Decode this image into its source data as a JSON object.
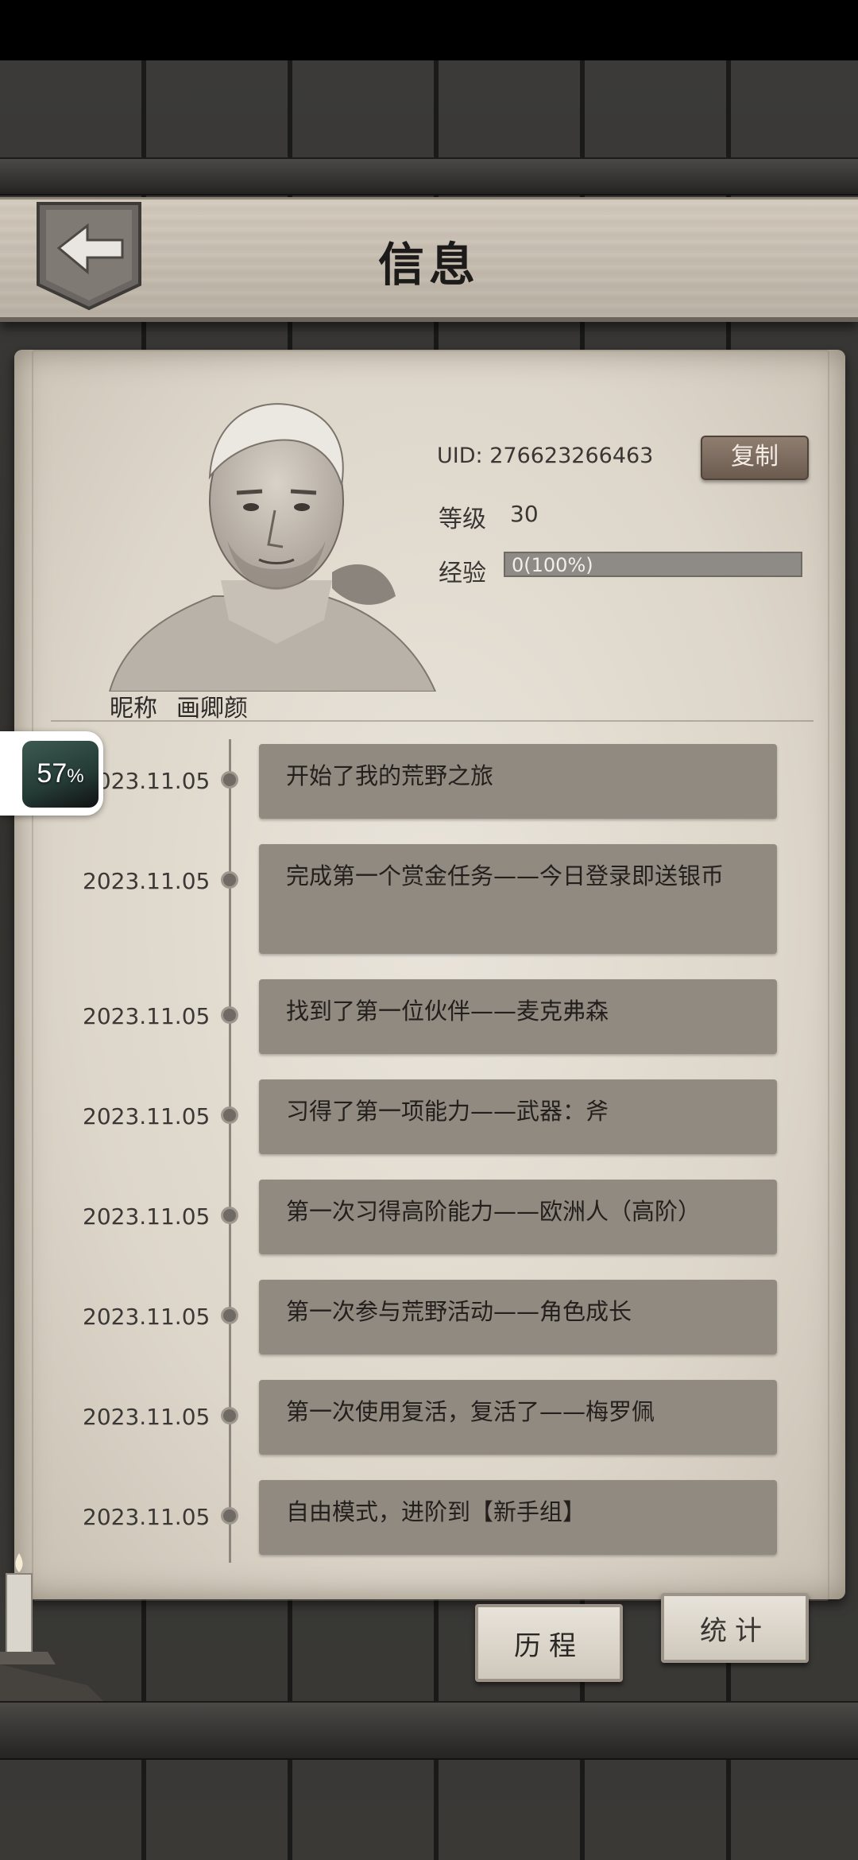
{
  "header": {
    "title": "信息"
  },
  "profile": {
    "uid_prefix": "UID:",
    "uid": "276623266463",
    "copy_label": "复制",
    "level_label": "等级",
    "level": "30",
    "exp_label": "经验",
    "exp_text": "0(100%)",
    "exp_fraction": 1.0,
    "nickname_label": "昵称",
    "nickname": "画卿颜"
  },
  "timeline": [
    {
      "date": "2023.11.05",
      "text": "开始了我的荒野之旅"
    },
    {
      "date": "2023.11.05",
      "text": "完成第一个赏金任务——今日登录即送银币"
    },
    {
      "date": "2023.11.05",
      "text": "找到了第一位伙伴——麦克弗森"
    },
    {
      "date": "2023.11.05",
      "text": "习得了第一项能力——武器：斧"
    },
    {
      "date": "2023.11.05",
      "text": "第一次习得高阶能力——欧洲人（高阶）"
    },
    {
      "date": "2023.11.05",
      "text": "第一次参与荒野活动——角色成长"
    },
    {
      "date": "2023.11.05",
      "text": "第一次使用复活，复活了——梅罗佩"
    },
    {
      "date": "2023.11.05",
      "text": "自由模式，进阶到【新手组】"
    }
  ],
  "tabs": {
    "history": "历程",
    "stats": "统计"
  },
  "overlay": {
    "percent": "57",
    "percent_sign": "%"
  }
}
